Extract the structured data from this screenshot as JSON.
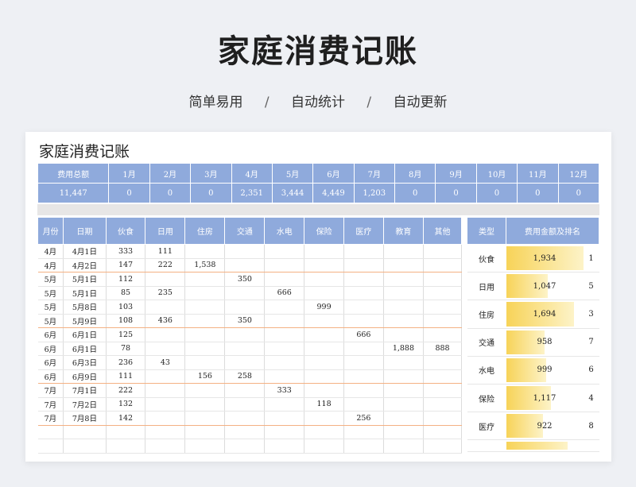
{
  "hero": {
    "title": "家庭消费记账",
    "features": [
      "简单易用",
      "自动统计",
      "自动更新"
    ],
    "separator": "/"
  },
  "sheet": {
    "title": "家庭消费记账",
    "monthly": {
      "headers": [
        "费用总额",
        "1月",
        "2月",
        "3月",
        "4月",
        "5月",
        "6月",
        "7月",
        "8月",
        "9月",
        "10月",
        "11月",
        "12月"
      ],
      "values": [
        "11,447",
        "0",
        "0",
        "0",
        "2,351",
        "3,444",
        "4,449",
        "1,203",
        "0",
        "0",
        "0",
        "0",
        "0"
      ]
    },
    "records": {
      "headers": [
        "月份",
        "日期",
        "伙食",
        "日用",
        "住房",
        "交通",
        "水电",
        "保险",
        "医疗",
        "教育",
        "其他"
      ],
      "rows": [
        [
          "4月",
          "4月1日",
          "333",
          "111",
          "",
          "",
          "",
          "",
          "",
          "",
          ""
        ],
        [
          "4月",
          "4月2日",
          "147",
          "222",
          "1,538",
          "",
          "",
          "",
          "",
          "",
          ""
        ],
        [
          "5月",
          "5月1日",
          "112",
          "",
          "",
          "350",
          "",
          "",
          "",
          "",
          ""
        ],
        [
          "5月",
          "5月1日",
          "85",
          "235",
          "",
          "",
          "666",
          "",
          "",
          "",
          ""
        ],
        [
          "5月",
          "5月8日",
          "103",
          "",
          "",
          "",
          "",
          "999",
          "",
          "",
          ""
        ],
        [
          "5月",
          "5月9日",
          "108",
          "436",
          "",
          "350",
          "",
          "",
          "",
          "",
          ""
        ],
        [
          "6月",
          "6月1日",
          "125",
          "",
          "",
          "",
          "",
          "",
          "666",
          "",
          ""
        ],
        [
          "6月",
          "6月1日",
          "78",
          "",
          "",
          "",
          "",
          "",
          "",
          "1,888",
          "888"
        ],
        [
          "6月",
          "6月3日",
          "236",
          "43",
          "",
          "",
          "",
          "",
          "",
          "",
          ""
        ],
        [
          "6月",
          "6月9日",
          "111",
          "",
          "156",
          "258",
          "",
          "",
          "",
          "",
          ""
        ],
        [
          "7月",
          "7月1日",
          "222",
          "",
          "",
          "",
          "333",
          "",
          "",
          "",
          ""
        ],
        [
          "7月",
          "7月2日",
          "132",
          "",
          "",
          "",
          "",
          "118",
          "",
          "",
          ""
        ],
        [
          "7月",
          "7月8日",
          "142",
          "",
          "",
          "",
          "",
          "",
          "256",
          "",
          ""
        ],
        [
          "",
          "",
          "",
          "",
          "",
          "",
          "",
          "",
          "",
          "",
          ""
        ],
        [
          "",
          "",
          "",
          "",
          "",
          "",
          "",
          "",
          "",
          "",
          ""
        ]
      ],
      "separator_after_rows": [
        1,
        5,
        9,
        12
      ]
    },
    "ranking": {
      "headers": [
        "类型",
        "费用金额及排名"
      ],
      "rows": [
        {
          "type": "伙食",
          "amount": "1,934",
          "rank": "1",
          "level": 1.0
        },
        {
          "type": "日用",
          "amount": "1,047",
          "rank": "5",
          "level": 0.54
        },
        {
          "type": "住房",
          "amount": "1,694",
          "rank": "3",
          "level": 0.88
        },
        {
          "type": "交通",
          "amount": "958",
          "rank": "7",
          "level": 0.5
        },
        {
          "type": "水电",
          "amount": "999",
          "rank": "6",
          "level": 0.52
        },
        {
          "type": "保险",
          "amount": "1,117",
          "rank": "4",
          "level": 0.58
        },
        {
          "type": "医疗",
          "amount": "922",
          "rank": "8",
          "level": 0.48
        }
      ]
    }
  },
  "colors": {
    "header_blue": "#8faadc",
    "month_separator": "#f4b183",
    "bar_gold": "#f7d358",
    "band_gray": "#e7e6e6"
  }
}
